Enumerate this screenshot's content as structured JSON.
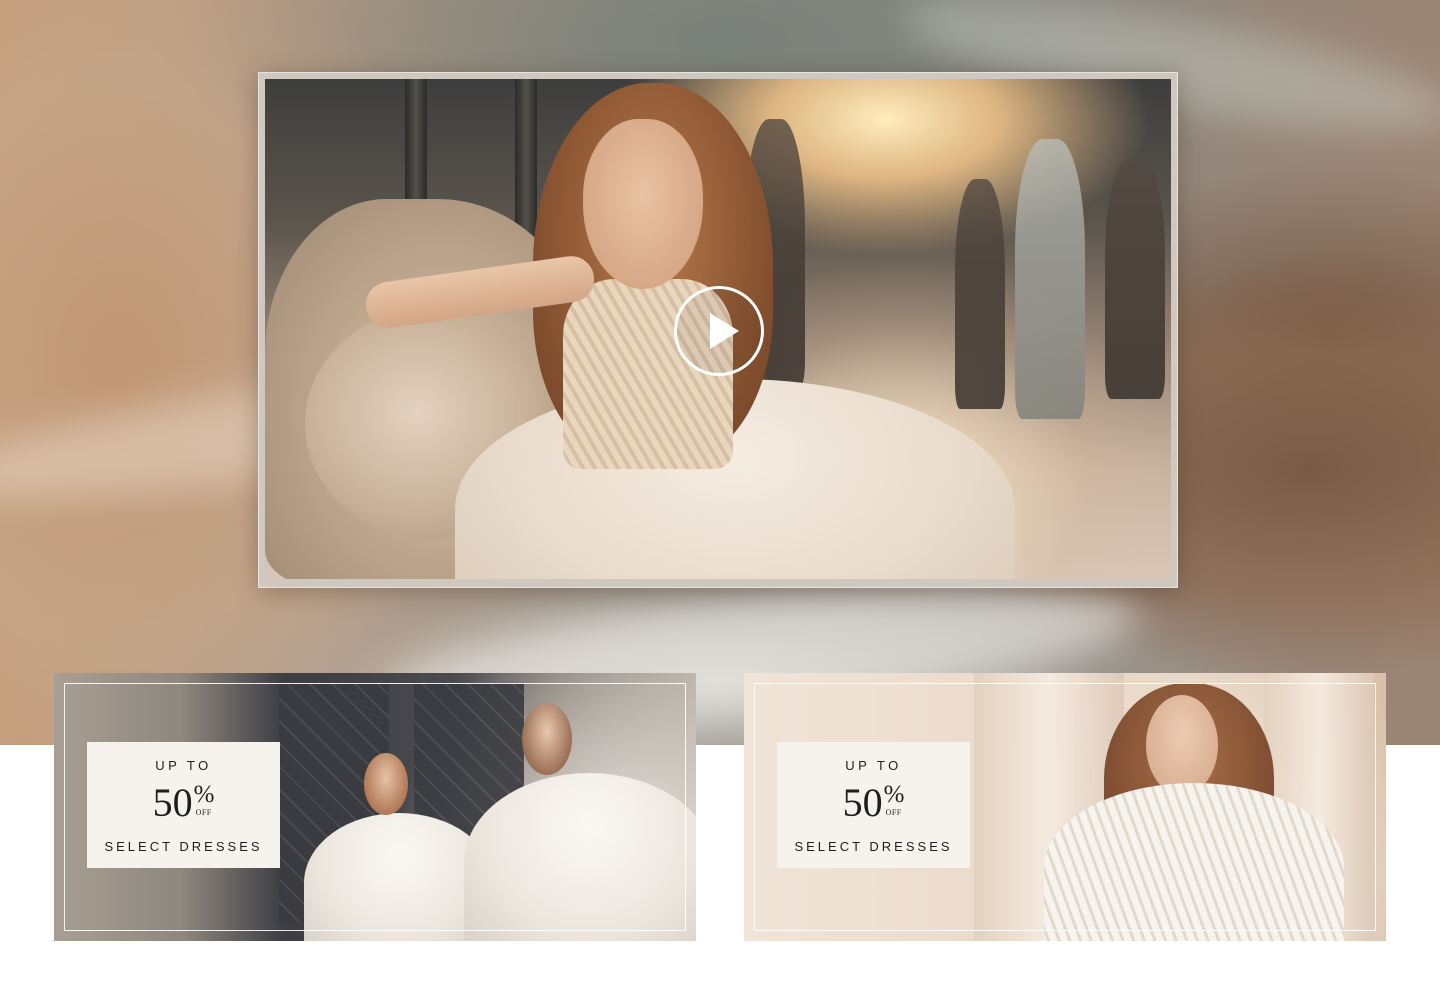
{
  "video": {
    "play_label": "",
    "play_icon": "play-icon"
  },
  "promos": [
    {
      "up_to": "UP TO",
      "number": "50",
      "percent": "%",
      "off": "OFF",
      "tagline": "SELECT DRESSES"
    },
    {
      "up_to": "UP TO",
      "number": "50",
      "percent": "%",
      "off": "OFF",
      "tagline": "SELECT DRESSES"
    }
  ],
  "colors": {
    "card_background": "#f6f3ef",
    "card_text": "#1e1e1e",
    "frame_border": "#ffffff"
  }
}
